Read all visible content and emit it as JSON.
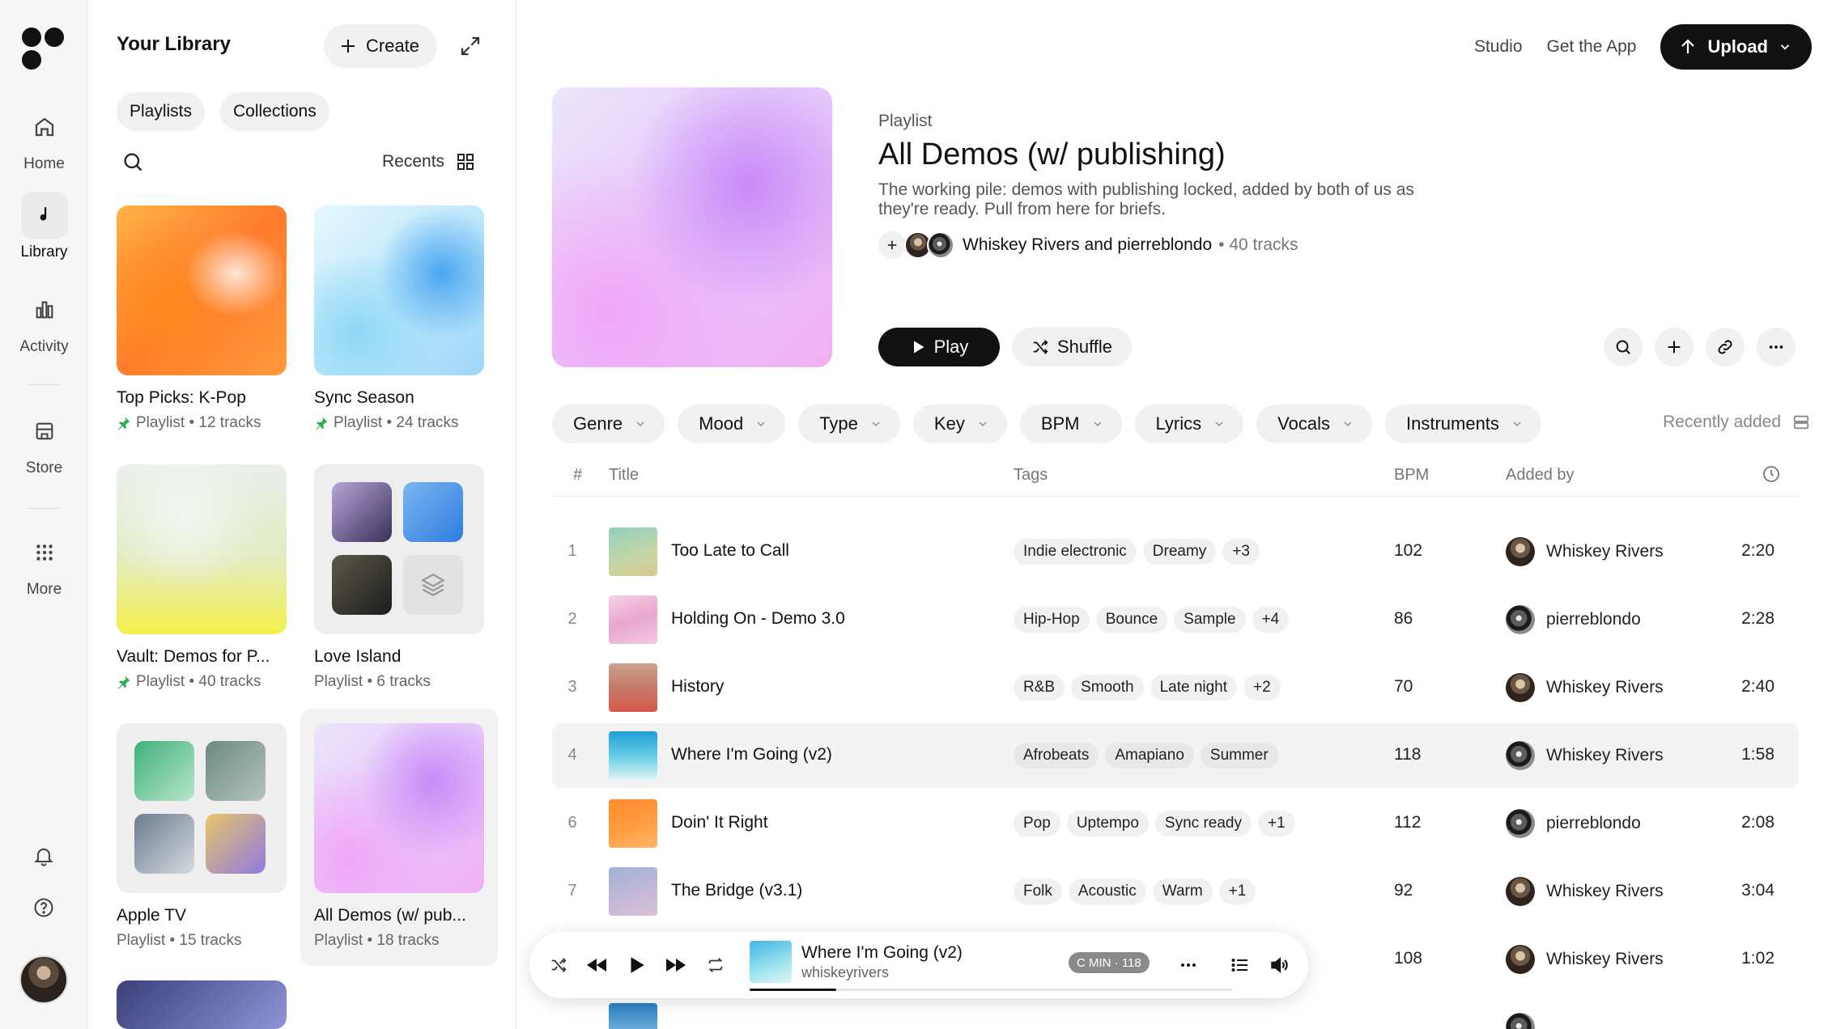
{
  "rail": {
    "items": [
      {
        "label": "Home"
      },
      {
        "label": "Library"
      },
      {
        "label": "Activity"
      },
      {
        "label": "Store"
      },
      {
        "label": "More"
      }
    ]
  },
  "library": {
    "title": "Your Library",
    "create_label": "Create",
    "tabs": [
      "Playlists",
      "Collections"
    ],
    "sort_label": "Recents",
    "cards": [
      {
        "name": "Top Picks: K-Pop",
        "meta": "Playlist • 12 tracks"
      },
      {
        "name": "Sync Season",
        "meta": "Playlist • 24 tracks"
      },
      {
        "name": "Vault: Demos for P...",
        "meta": "Playlist • 40 tracks"
      },
      {
        "name": "Love Island",
        "meta": "Playlist • 6 tracks"
      },
      {
        "name": "Apple TV",
        "meta": "Playlist • 15 tracks"
      },
      {
        "name": "All Demos (w/ pub...",
        "meta": "Playlist • 18 tracks"
      }
    ]
  },
  "topnav": {
    "studio": "Studio",
    "get_app": "Get the App",
    "upload": "Upload"
  },
  "playlist": {
    "type": "Playlist",
    "title": "All Demos (w/ publishing)",
    "description": "The working pile: demos with publishing locked, added by both of us as they're ready. Pull from here for briefs.",
    "owners": "Whiskey Rivers and pierreblondo",
    "track_count": "• 40 tracks",
    "play_label": "Play",
    "shuffle_label": "Shuffle"
  },
  "filters": [
    "Genre",
    "Mood",
    "Type",
    "Key",
    "BPM",
    "Lyrics",
    "Vocals",
    "Instruments"
  ],
  "sort_label": "Recently added",
  "table": {
    "headers": {
      "num": "#",
      "title": "Title",
      "tags": "Tags",
      "bpm": "BPM",
      "added_by": "Added by"
    },
    "rows": [
      {
        "num": "1",
        "title": "Too Late to Call",
        "tags": [
          "Indie electronic",
          "Dreamy",
          "+3"
        ],
        "bpm": "102",
        "added_by": "Whiskey Rivers",
        "duration": "2:20"
      },
      {
        "num": "2",
        "title": "Holding On - Demo 3.0",
        "tags": [
          "Hip-Hop",
          "Bounce",
          "Sample",
          "+4"
        ],
        "bpm": "86",
        "added_by": "pierreblondo",
        "duration": "2:28"
      },
      {
        "num": "3",
        "title": "History",
        "tags": [
          "R&B",
          "Smooth",
          "Late night",
          "+2"
        ],
        "bpm": "70",
        "added_by": "Whiskey Rivers",
        "duration": "2:40"
      },
      {
        "num": "4",
        "title": "Where I'm Going (v2)",
        "tags": [
          "Afrobeats",
          "Amapiano",
          "Summer"
        ],
        "bpm": "118",
        "added_by": "Whiskey Rivers",
        "duration": "1:58"
      },
      {
        "num": "6",
        "title": "Doin' It Right",
        "tags": [
          "Pop",
          "Uptempo",
          "Sync ready",
          "+1"
        ],
        "bpm": "112",
        "added_by": "pierreblondo",
        "duration": "2:08"
      },
      {
        "num": "7",
        "title": "The Bridge (v3.1)",
        "tags": [
          "Folk",
          "Acoustic",
          "Warm",
          "+1"
        ],
        "bpm": "92",
        "added_by": "Whiskey Rivers",
        "duration": "3:04"
      },
      {
        "num": "",
        "title": "",
        "tags": [],
        "bpm": "108",
        "added_by": "Whiskey Rivers",
        "duration": "1:02"
      }
    ]
  },
  "player": {
    "title": "Where I'm Going (v2)",
    "artist": "whiskeyrivers",
    "badge": "C MIN · 118",
    "progress": 0.18
  }
}
